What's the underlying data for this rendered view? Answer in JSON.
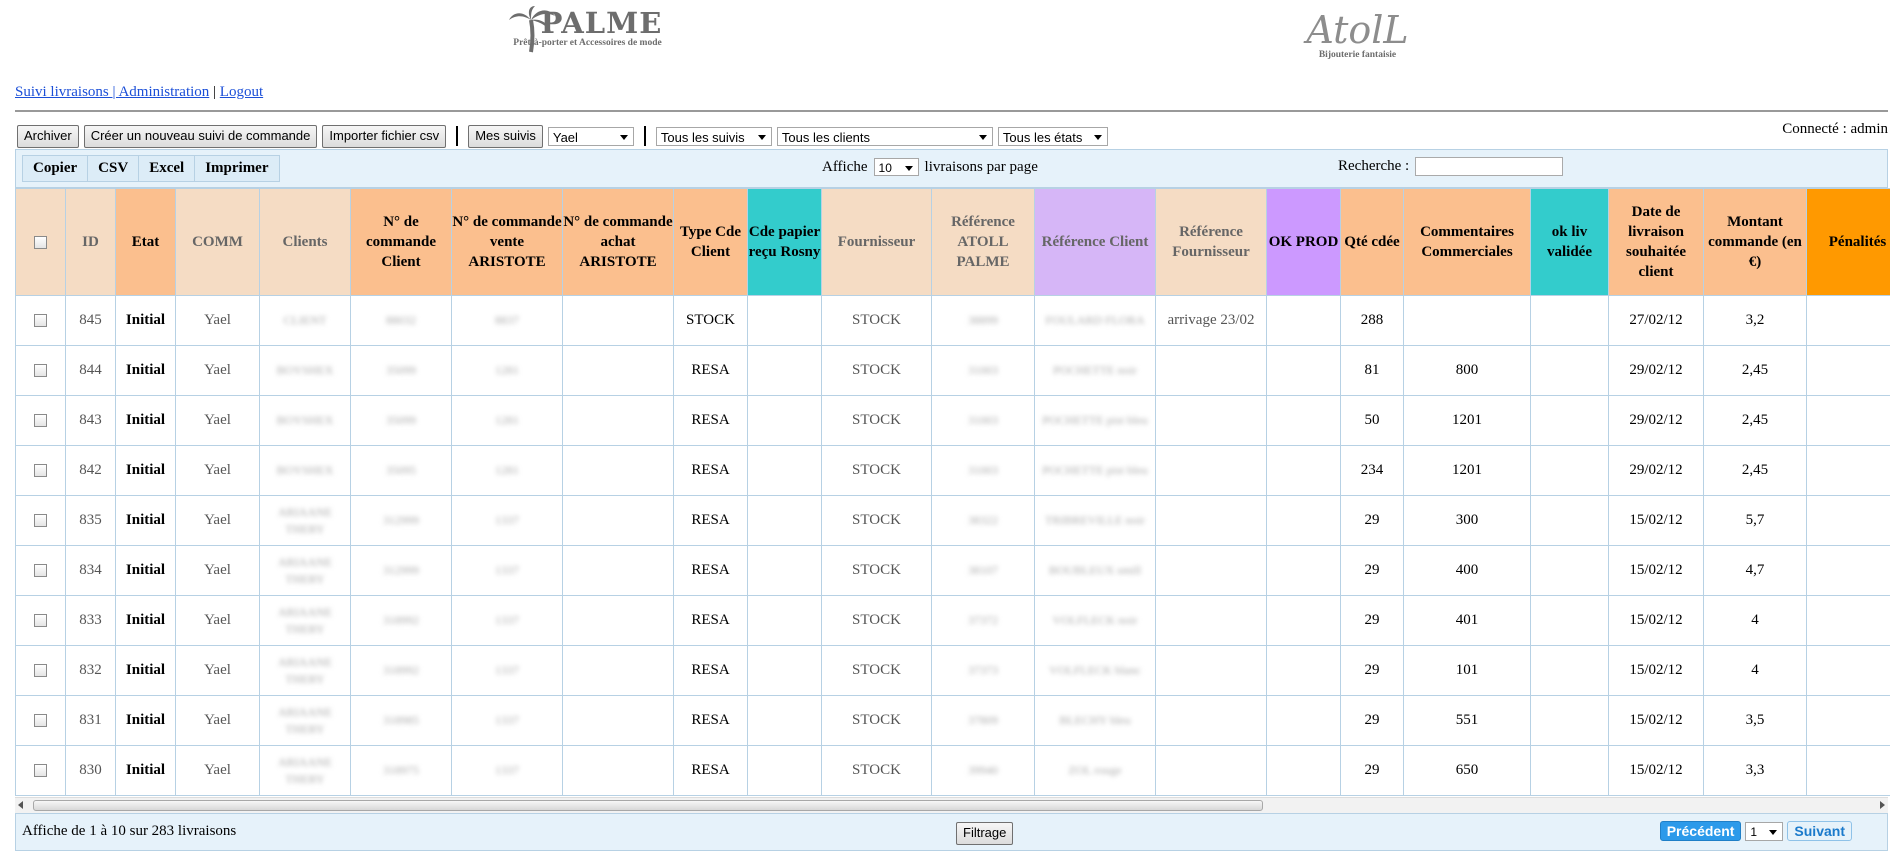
{
  "logos": {
    "palme_name": "PALME",
    "palme_tagline": "Prêt-à-porter et Accessoires de mode",
    "atoll_name": "AtolL",
    "atoll_tagline": "Bijouterie fantaisie"
  },
  "nav": {
    "suivi": "Suivi livraisons ",
    "sep1": "| ",
    "admin": "Administration",
    "sep2": " | ",
    "logout": "Logout"
  },
  "toolbar": {
    "archiver": "Archiver",
    "creer": "Créer un nouveau suivi de commande",
    "importer": "Importer fichier csv",
    "mes_suivis": "Mes suivis",
    "user_select": "Yael",
    "suivis_select": "Tous les suivis",
    "clients_select": "Tous les clients",
    "etats_select": "Tous les états"
  },
  "connected": "Connecté : admin",
  "export_tools": [
    "Copier",
    "CSV",
    "Excel",
    "Imprimer"
  ],
  "length": {
    "prefix": "Affiche",
    "value": "10",
    "suffix": "livraisons par page"
  },
  "search": {
    "label": "Recherche :",
    "value": ""
  },
  "table": {
    "headers": [
      "ID",
      "Etat",
      "COMM",
      "Clients",
      "N° de commande Client",
      "N° de commande vente ARISTOTE",
      "N° de commande achat ARISTOTE",
      "Type Cde Client",
      "Cde papier reçu Rosny",
      "Fournisseur",
      "Référence ATOLL PALME",
      "Référence Client",
      "Référence Fournisseur",
      "OK PROD",
      "Qté cdée",
      "Commentaires Commerciales",
      "ok liv validée",
      "Date de livraison souhaitée client",
      "Montant commande (en €)",
      "Pénalités"
    ],
    "header_colors": [
      "#f5dcc4",
      "#fbbf8e",
      "#f5dcc4",
      "#f5dcc4",
      "#fbbf8e",
      "#fbbf8e",
      "#fbbf8e",
      "#fbbf8e",
      "#33cccc",
      "#f5dcc4",
      "#f5dcc4",
      "#d6b6f7",
      "#f5dcc4",
      "#cc99ff",
      "#fbbf8e",
      "#fbbf8e",
      "#33cccc",
      "#fbbf8e",
      "#fbbf8e",
      "#ff9900"
    ],
    "rows": [
      {
        "id": "845",
        "etat": "Initial",
        "comm": "Yael",
        "client": "CLIENT",
        "cmd_client": "88032",
        "vente": "8837",
        "achat": "",
        "type": "STOCK",
        "papier": "",
        "fournisseur": "STOCK",
        "ref_atoll": "38899",
        "ref_client": "FOULARD FLORA",
        "ref_fourn": "arrivage 23/02",
        "ok_prod": "",
        "qte": "288",
        "comment": "",
        "ok_liv": "",
        "date": "27/02/12",
        "montant": "3,2",
        "penal": ""
      },
      {
        "id": "844",
        "etat": "Initial",
        "comm": "Yael",
        "client": "BOYSHEX",
        "cmd_client": "35099",
        "vente": "1281",
        "achat": "",
        "type": "RESA",
        "papier": "",
        "fournisseur": "STOCK",
        "ref_atoll": "31003",
        "ref_client": "POCHETTE noir",
        "ref_fourn": "",
        "ok_prod": "",
        "qte": "81",
        "comment": "800",
        "ok_liv": "",
        "date": "29/02/12",
        "montant": "2,45",
        "penal": ""
      },
      {
        "id": "843",
        "etat": "Initial",
        "comm": "Yael",
        "client": "BOYSHEX",
        "cmd_client": "35099",
        "vente": "1281",
        "achat": "",
        "type": "RESA",
        "papier": "",
        "fournisseur": "STOCK",
        "ref_atoll": "31003",
        "ref_client": "POCHETTE pist bleu",
        "ref_fourn": "",
        "ok_prod": "",
        "qte": "50",
        "comment": "1201",
        "ok_liv": "",
        "date": "29/02/12",
        "montant": "2,45",
        "penal": ""
      },
      {
        "id": "842",
        "etat": "Initial",
        "comm": "Yael",
        "client": "BOYSHEX",
        "cmd_client": "35095",
        "vente": "1281",
        "achat": "",
        "type": "RESA",
        "papier": "",
        "fournisseur": "STOCK",
        "ref_atoll": "31003",
        "ref_client": "POCHETTE pist bleu",
        "ref_fourn": "",
        "ok_prod": "",
        "qte": "234",
        "comment": "1201",
        "ok_liv": "",
        "date": "29/02/12",
        "montant": "2,45",
        "penal": ""
      },
      {
        "id": "835",
        "etat": "Initial",
        "comm": "Yael",
        "client": "ARIAANE THERY",
        "cmd_client": "312999",
        "vente": "1337",
        "achat": "",
        "type": "RESA",
        "papier": "",
        "fournisseur": "STOCK",
        "ref_atoll": "38322",
        "ref_client": "TRIBREVILLE noir",
        "ref_fourn": "",
        "ok_prod": "",
        "qte": "29",
        "comment": "300",
        "ok_liv": "",
        "date": "15/02/12",
        "montant": "5,7",
        "penal": ""
      },
      {
        "id": "834",
        "etat": "Initial",
        "comm": "Yael",
        "client": "ARIAANE THERY",
        "cmd_client": "312999",
        "vente": "1337",
        "achat": "",
        "type": "RESA",
        "papier": "",
        "fournisseur": "STOCK",
        "ref_atoll": "38107",
        "ref_client": "BOUBLEUX smill",
        "ref_fourn": "",
        "ok_prod": "",
        "qte": "29",
        "comment": "400",
        "ok_liv": "",
        "date": "15/02/12",
        "montant": "4,7",
        "penal": ""
      },
      {
        "id": "833",
        "etat": "Initial",
        "comm": "Yael",
        "client": "ARIAANE THERY",
        "cmd_client": "318992",
        "vente": "1337",
        "achat": "",
        "type": "RESA",
        "papier": "",
        "fournisseur": "STOCK",
        "ref_atoll": "37372",
        "ref_client": "VOLFLECK noir",
        "ref_fourn": "",
        "ok_prod": "",
        "qte": "29",
        "comment": "401",
        "ok_liv": "",
        "date": "15/02/12",
        "montant": "4",
        "penal": ""
      },
      {
        "id": "832",
        "etat": "Initial",
        "comm": "Yael",
        "client": "ARIAANE THERY",
        "cmd_client": "318992",
        "vente": "1337",
        "achat": "",
        "type": "RESA",
        "papier": "",
        "fournisseur": "STOCK",
        "ref_atoll": "37373",
        "ref_client": "VOLFLECK blanc",
        "ref_fourn": "",
        "ok_prod": "",
        "qte": "29",
        "comment": "101",
        "ok_liv": "",
        "date": "15/02/12",
        "montant": "4",
        "penal": ""
      },
      {
        "id": "831",
        "etat": "Initial",
        "comm": "Yael",
        "client": "ARIAANE THERY",
        "cmd_client": "318985",
        "vente": "1337",
        "achat": "",
        "type": "RESA",
        "papier": "",
        "fournisseur": "STOCK",
        "ref_atoll": "37809",
        "ref_client": "BLECHY bleu",
        "ref_fourn": "",
        "ok_prod": "",
        "qte": "29",
        "comment": "551",
        "ok_liv": "",
        "date": "15/02/12",
        "montant": "3,5",
        "penal": ""
      },
      {
        "id": "830",
        "etat": "Initial",
        "comm": "Yael",
        "client": "ARIAANE THERY",
        "cmd_client": "318975",
        "vente": "1337",
        "achat": "",
        "type": "RESA",
        "papier": "",
        "fournisseur": "STOCK",
        "ref_atoll": "39940",
        "ref_client": "ZOL rouge",
        "ref_fourn": "",
        "ok_prod": "",
        "qte": "29",
        "comment": "650",
        "ok_liv": "",
        "date": "15/02/12",
        "montant": "3,3",
        "penal": ""
      }
    ]
  },
  "footer": {
    "info": "Affiche de 1 à 10 sur 283 livraisons",
    "filtrage": "Filtrage",
    "prev": "Précédent",
    "page": "1",
    "next": "Suivant"
  }
}
